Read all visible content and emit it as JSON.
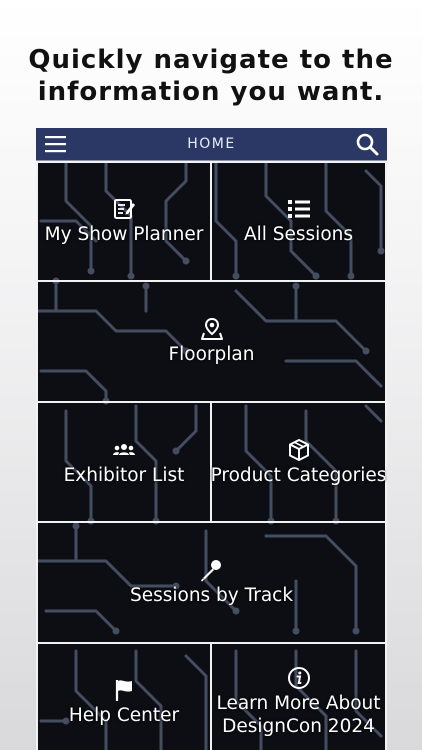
{
  "promo": {
    "line1": "Quickly navigate to the",
    "line2": "information you want."
  },
  "navbar": {
    "title": "HOME",
    "menu_icon": "hamburger-menu-icon",
    "search_icon": "search-icon",
    "color": "#2b3865"
  },
  "tiles": [
    {
      "label": "My Show Planner",
      "icon": "planner-notepad-icon"
    },
    {
      "label": "All Sessions",
      "icon": "list-icon"
    },
    {
      "label": "Floorplan",
      "icon": "map-pin-icon"
    },
    {
      "label": "Exhibitor List",
      "icon": "people-group-icon"
    },
    {
      "label": "Product Categories",
      "icon": "box-icon"
    },
    {
      "label": "Sessions by Track",
      "icon": "microphone-icon"
    },
    {
      "label": "Help Center",
      "icon": "flag-icon"
    },
    {
      "label": "Learn More About DesignCon 2024",
      "line1": "Learn More About",
      "line2": "DesignCon 2024",
      "icon": "info-icon"
    }
  ],
  "colors": {
    "tile_background": "#0c0e14",
    "circuit_trace": "#4a5266",
    "tile_border": "#f2f2f2",
    "text": "#ffffff"
  }
}
